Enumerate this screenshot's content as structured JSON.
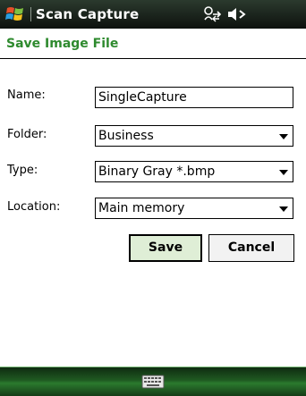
{
  "titlebar": {
    "app_title": "Scan Capture"
  },
  "page": {
    "title": "Save Image File"
  },
  "form": {
    "name": {
      "label": "Name:",
      "value": "SingleCapture"
    },
    "folder": {
      "label": "Folder:",
      "value": "Business"
    },
    "type": {
      "label": "Type:",
      "value": "Binary Gray *.bmp"
    },
    "location": {
      "label": "Location:",
      "value": "Main memory"
    }
  },
  "buttons": {
    "save_label": "Save",
    "cancel_label": "Cancel"
  },
  "icons": {
    "start": "windows-flag-icon",
    "connectivity": "connectivity-icon",
    "volume": "speaker-muted-icon",
    "keyboard": "keyboard-icon"
  },
  "colors": {
    "accent_green": "#2e8a2e",
    "save_button_bg": "#dfeed6",
    "titlebar_bg": "#0d110e",
    "bottombar_bg": "#1f5a21"
  }
}
